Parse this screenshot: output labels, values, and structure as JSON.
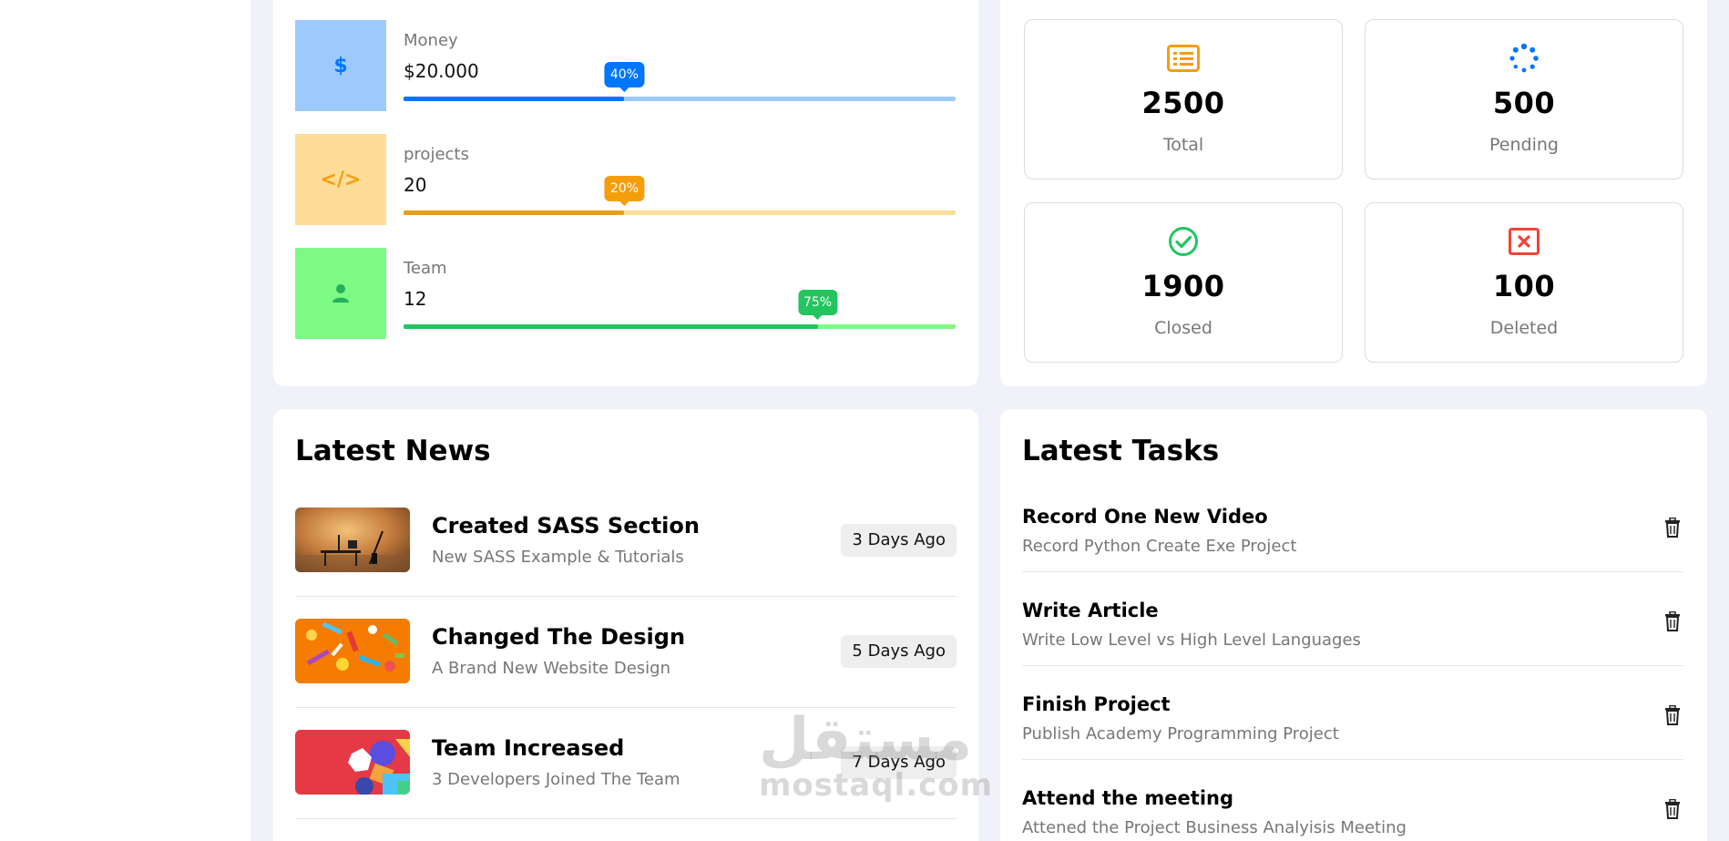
{
  "colors": {
    "blue": "#0075ff",
    "orange": "#f59e0b",
    "green": "#22c55e",
    "red": "#f44336",
    "page_bg": "#f1f2f9"
  },
  "targets": [
    {
      "icon": "dollar-icon",
      "symbol": "$",
      "label": "Money",
      "value": "$20.000",
      "percent_text": "40%",
      "progress": 0.4
    },
    {
      "icon": "code-icon",
      "symbol": "</>",
      "label": "projects",
      "value": "20",
      "percent_text": "20%",
      "progress": 0.4
    },
    {
      "icon": "user-icon",
      "symbol": "",
      "label": "Team",
      "value": "12",
      "percent_text": "75%",
      "progress": 0.75
    }
  ],
  "tickets": [
    {
      "icon": "list-icon",
      "value": "2500",
      "label": "Total"
    },
    {
      "icon": "spinner-icon",
      "value": "500",
      "label": "Pending"
    },
    {
      "icon": "check-circle-icon",
      "value": "1900",
      "label": "Closed"
    },
    {
      "icon": "close-box-icon",
      "value": "100",
      "label": "Deleted"
    }
  ],
  "news": {
    "title": "Latest News",
    "items": [
      {
        "title": "Created SASS Section",
        "desc": "New SASS Example & Tutorials",
        "date": "3 Days Ago"
      },
      {
        "title": "Changed The Design",
        "desc": "A Brand New Website Design",
        "date": "5 Days Ago"
      },
      {
        "title": "Team Increased",
        "desc": "3 Developers Joined The Team",
        "date": "7 Days Ago"
      }
    ]
  },
  "tasks": {
    "title": "Latest Tasks",
    "items": [
      {
        "title": "Record One New Video",
        "desc": "Record Python Create Exe Project"
      },
      {
        "title": "Write Article",
        "desc": "Write Low Level vs High Level Languages"
      },
      {
        "title": "Finish Project",
        "desc": "Publish Academy Programming Project"
      },
      {
        "title": "Attend the meeting",
        "desc": "Attened the Project Business Analyisis Meeting"
      }
    ]
  },
  "watermark": {
    "arabic": "مستقل",
    "latin": "mostaql.com"
  }
}
